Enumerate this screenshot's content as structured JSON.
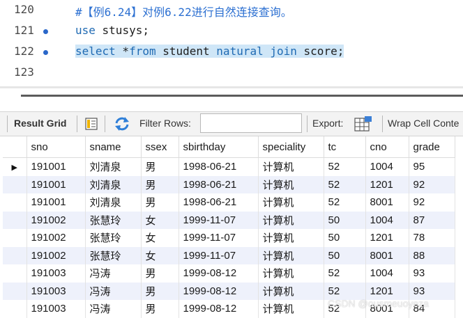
{
  "editor": {
    "lines": [
      {
        "num": "120",
        "marker": false,
        "comment": "#【例6.24】对例6.22进行自然连接查询。"
      },
      {
        "num": "121",
        "marker": true,
        "kw1": "use",
        "rest1": " stusys;"
      },
      {
        "num": "122",
        "marker": true,
        "kw1": "select",
        "rest1": " *",
        "kw2": "from",
        "rest2": " student ",
        "kw3": "natural",
        "rest3": " ",
        "kw4": "join",
        "rest4": " score;"
      },
      {
        "num": "123",
        "marker": false
      }
    ]
  },
  "toolbar": {
    "result_grid": "Result Grid",
    "filter_rows": "Filter Rows:",
    "filter_value": "",
    "export": "Export:",
    "wrap_cell": "Wrap Cell Conte"
  },
  "grid": {
    "columns": [
      "sno",
      "sname",
      "ssex",
      "sbirthday",
      "speciality",
      "tc",
      "cno",
      "grade"
    ],
    "rows": [
      [
        "191001",
        "刘清泉",
        "男",
        "1998-06-21",
        "计算机",
        "52",
        "1004",
        "95"
      ],
      [
        "191001",
        "刘清泉",
        "男",
        "1998-06-21",
        "计算机",
        "52",
        "1201",
        "92"
      ],
      [
        "191001",
        "刘清泉",
        "男",
        "1998-06-21",
        "计算机",
        "52",
        "8001",
        "92"
      ],
      [
        "191002",
        "张慧玲",
        "女",
        "1999-11-07",
        "计算机",
        "50",
        "1004",
        "87"
      ],
      [
        "191002",
        "张慧玲",
        "女",
        "1999-11-07",
        "计算机",
        "50",
        "1201",
        "78"
      ],
      [
        "191002",
        "张慧玲",
        "女",
        "1999-11-07",
        "计算机",
        "50",
        "8001",
        "88"
      ],
      [
        "191003",
        "冯涛",
        "男",
        "1999-08-12",
        "计算机",
        "52",
        "1004",
        "93"
      ],
      [
        "191003",
        "冯涛",
        "男",
        "1999-08-12",
        "计算机",
        "52",
        "1201",
        "93"
      ],
      [
        "191003",
        "冯涛",
        "男",
        "1999-08-12",
        "计算机",
        "52",
        "8001",
        "84"
      ]
    ],
    "current_row_marker": "▶"
  },
  "watermark": "CSDN @ousmeuoyeza",
  "colors": {
    "keyword": "#1f6ab3",
    "comment": "#2b6fd1",
    "highlight": "#cfe6f7",
    "alt_row": "#eef1fb"
  }
}
